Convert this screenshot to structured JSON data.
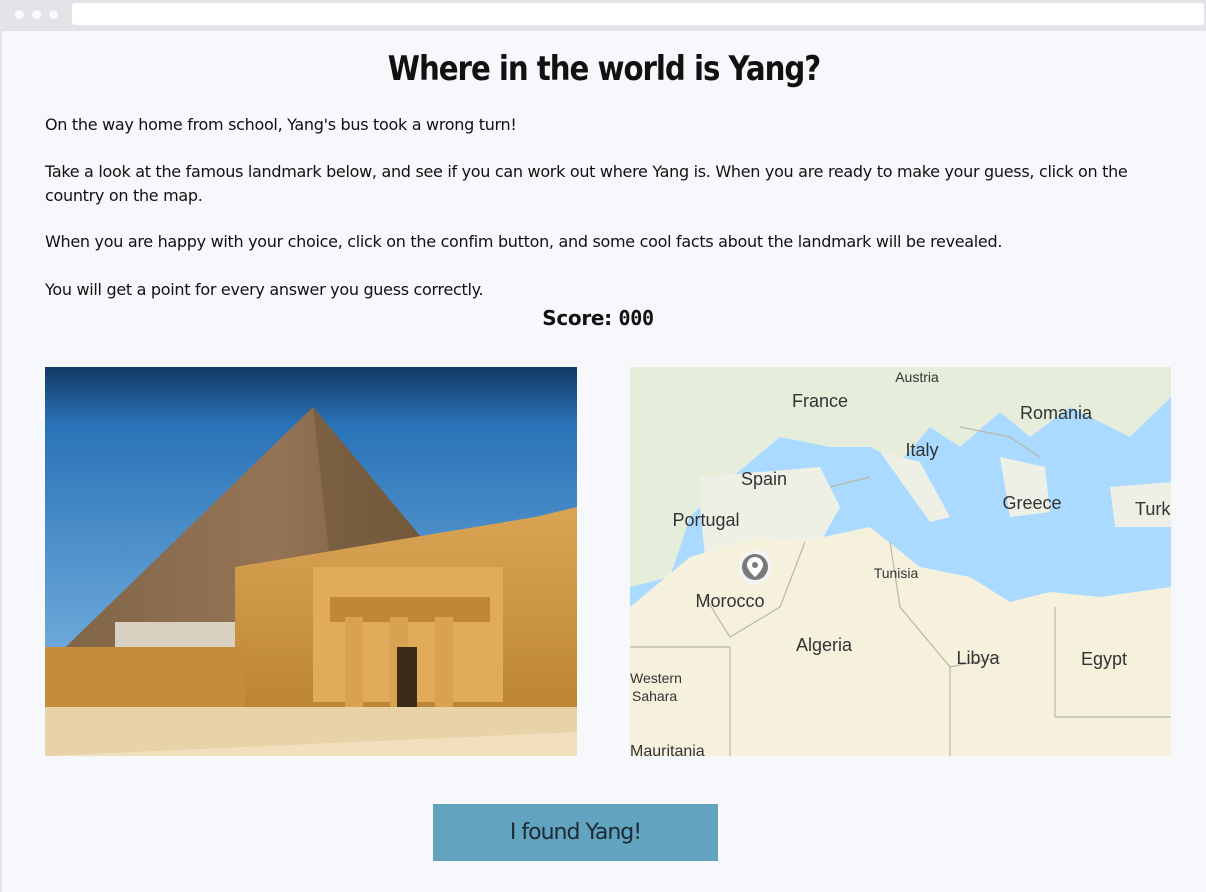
{
  "page": {
    "title": "Where in the world is Yang?",
    "paragraphs": [
      "On the way home from school, Yang's bus took a wrong turn!",
      "Take a look at the famous landmark below, and see if you can work out where Yang is. When you are ready to make your guess, click on the country on the map.",
      "When you are happy with your choice, click on the confim button, and some cool facts about the landmark will be revealed.",
      "You will get a point for every answer you guess correctly."
    ],
    "score_label": "Score:",
    "score_value": "000"
  },
  "map": {
    "labels": [
      "Austria",
      "France",
      "Romania",
      "Italy",
      "Spain",
      "Greece",
      "Turk",
      "Portugal",
      "Tunisia",
      "Morocco",
      "Algeria",
      "Libya",
      "Egypt",
      "Western",
      "Sahara",
      "Mauritania"
    ],
    "pin": "location-pin-icon"
  },
  "button": {
    "label": "I found Yang!"
  },
  "colors": {
    "button": "#62a3bf",
    "sea": "#aadaff",
    "land": "#f6f1dd",
    "sky": "#2e7fc1",
    "stone": "#c9913e"
  }
}
